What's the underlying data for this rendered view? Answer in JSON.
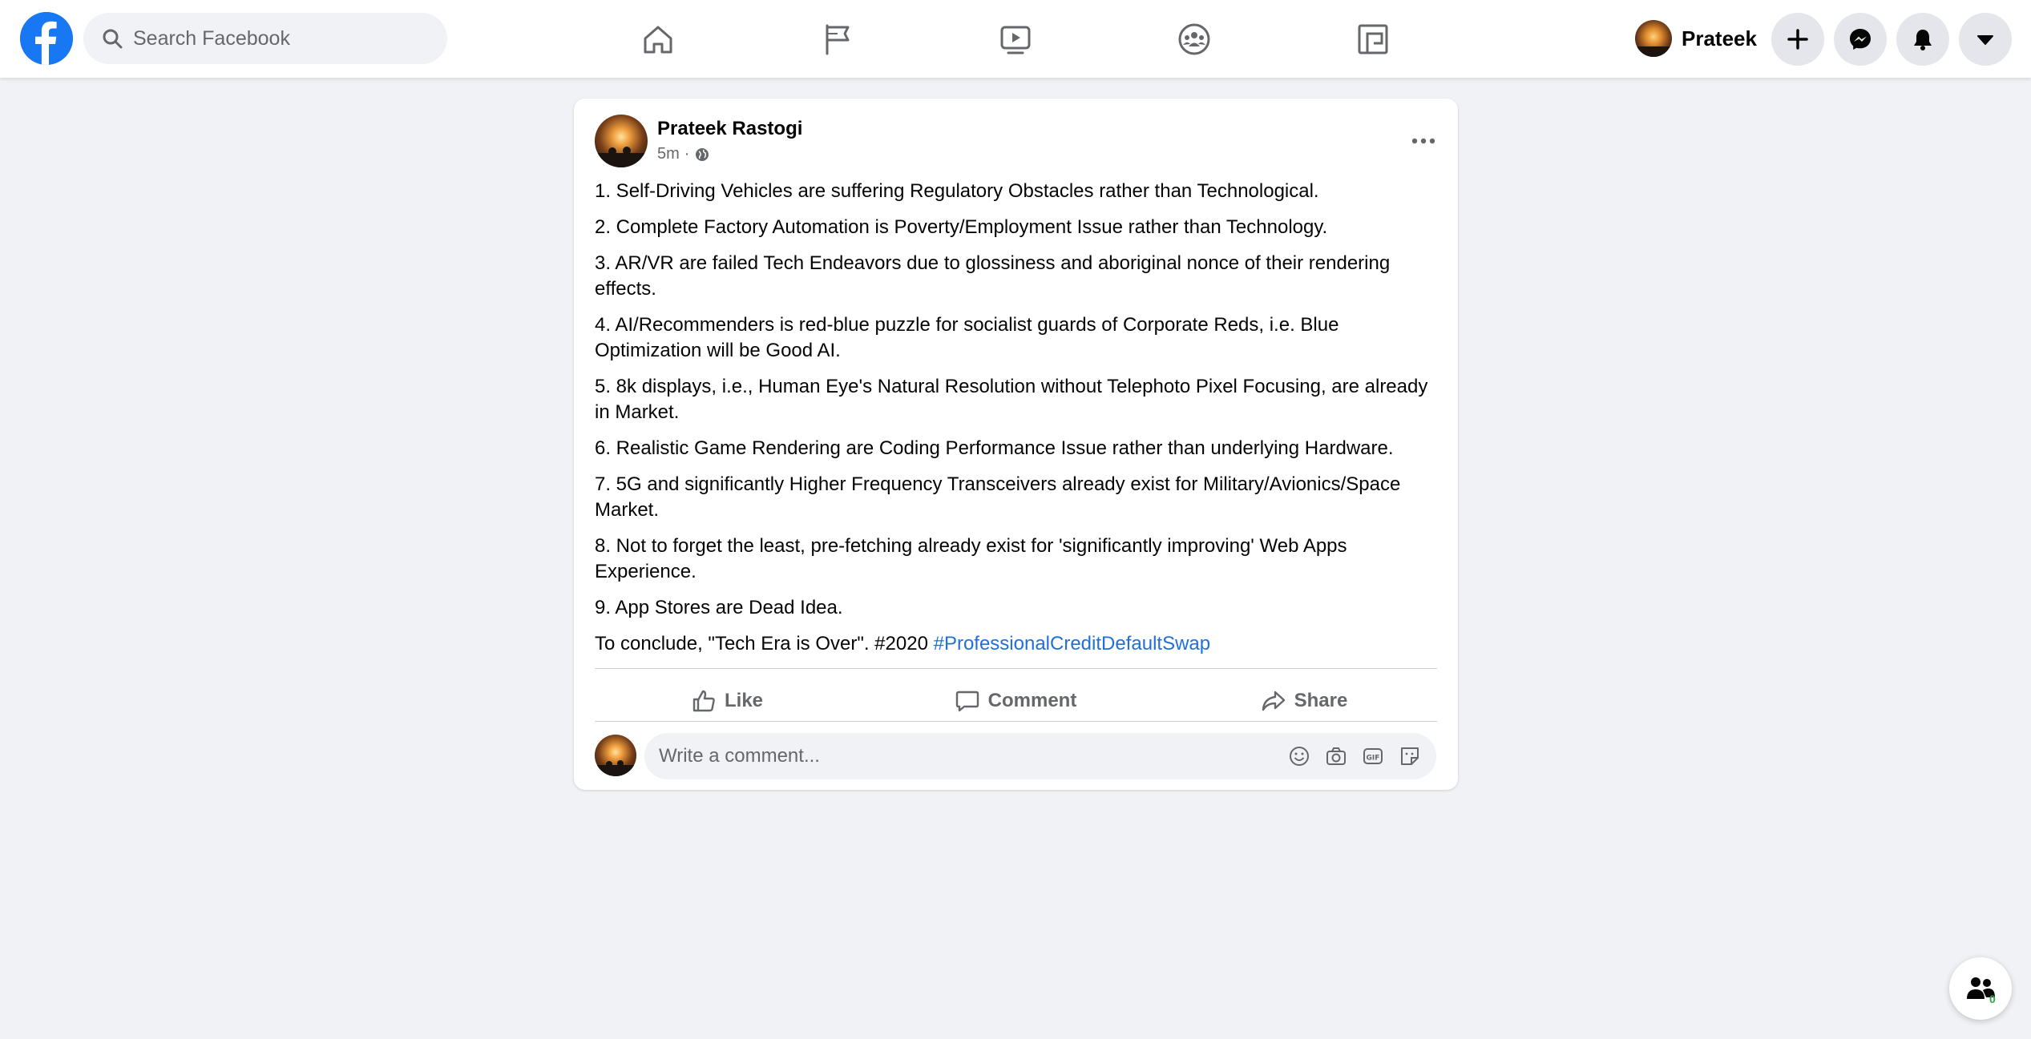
{
  "topbar": {
    "logo_icon": "facebook-logo-icon",
    "search": {
      "placeholder": "Search Facebook",
      "value": ""
    },
    "nav": [
      {
        "name": "home",
        "icon": "home-icon"
      },
      {
        "name": "pages",
        "icon": "flag-icon"
      },
      {
        "name": "watch",
        "icon": "video-play-icon"
      },
      {
        "name": "groups",
        "icon": "groups-icon"
      },
      {
        "name": "gaming",
        "icon": "gaming-icon"
      }
    ],
    "profile_name": "Prateek",
    "buttons": [
      "plus-icon",
      "messenger-icon",
      "bell-icon",
      "caret-down-icon"
    ]
  },
  "post": {
    "author": "Prateek Rastogi",
    "time": "5m",
    "separator": "·",
    "privacy_icon": "globe-icon",
    "paragraphs": [
      "1. Self-Driving Vehicles are suffering Regulatory Obstacles rather than Technological.",
      "2. Complete Factory Automation is Poverty/Employment Issue rather than Technology.",
      "3. AR/VR are failed Tech Endeavors due to glossiness and aboriginal nonce of their rendering effects.",
      "4. AI/Recommenders is red-blue puzzle for socialist guards of Corporate Reds, i.e. Blue Optimization will be Good AI.",
      "5. 8k displays, i.e., Human Eye's Natural Resolution without Telephoto Pixel Focusing, are already in Market.",
      "6. Realistic Game Rendering are Coding Performance Issue rather than underlying Hardware.",
      "7. 5G and significantly Higher Frequency Transceivers already exist for Military/Avionics/Space Market.",
      "8. Not to forget the least, pre-fetching already exist for 'significantly improving' Web Apps Experience.",
      "9. App Stores are Dead Idea."
    ],
    "conclusion": "To conclude, \"Tech Era is Over\". #2020 ",
    "hashtag": "#ProfessionalCreditDefaultSwap",
    "actions": {
      "like": "Like",
      "comment": "Comment",
      "share": "Share"
    },
    "comment_placeholder": "Write a comment...",
    "comment_icons": [
      "emoji-icon",
      "camera-icon",
      "gif-icon",
      "sticker-icon"
    ]
  },
  "contacts": {
    "badge": "0"
  },
  "colors": {
    "brand": "#1877f2",
    "hashtag": "#216fdb",
    "background": "#f0f2f5",
    "secondary_text": "#65676b"
  }
}
